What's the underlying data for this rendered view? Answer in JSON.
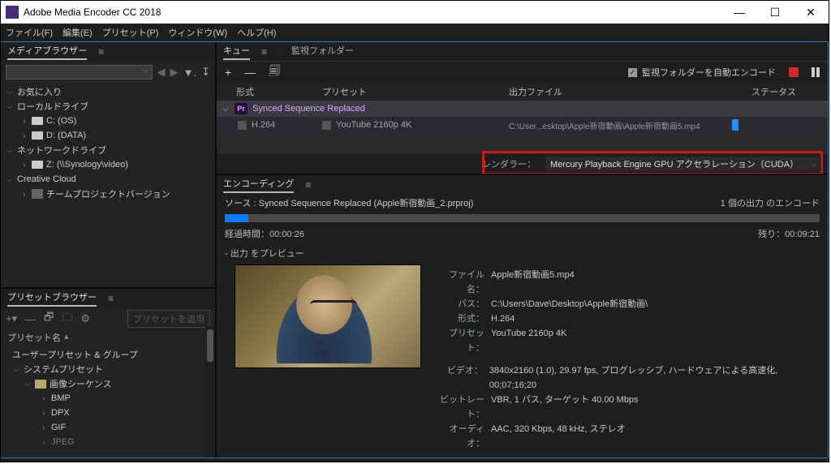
{
  "window": {
    "title": "Adobe Media Encoder CC 2018"
  },
  "menubar": {
    "file": "ファイル(F)",
    "edit": "編集(E)",
    "preset": "プリセット(P)",
    "window": "ウィンドウ(W)",
    "help": "ヘルプ(H)"
  },
  "media_browser": {
    "tab": "メディアブラウザー",
    "tree": {
      "favorites": "お気に入り",
      "local_drives": "ローカルドライブ",
      "c_drive": "C: (OS)",
      "d_drive": "D: (DATA)",
      "network_drives": "ネットワークドライブ",
      "z_drive": "Z: (\\\\Synology\\video)",
      "creative_cloud": "Creative Cloud",
      "team_projects": "チームプロジェクトバージョン"
    }
  },
  "preset_browser": {
    "tab": "プリセットブラウザー",
    "apply": "プリセットを適用",
    "col_name": "プリセット名",
    "user_presets": "ユーザープリセット & グループ",
    "system_presets": "システムプリセット",
    "image_sequence": "画像シーケンス",
    "items": [
      "BMP",
      "DPX",
      "GIF",
      "JPEG"
    ]
  },
  "queue": {
    "tab_queue": "キュー",
    "tab_watch": "監視フォルダー",
    "auto_encode": "監視フォルダーを自動エンコード",
    "headers": {
      "format": "形式",
      "preset": "プリセット",
      "output": "出力ファイル",
      "status": "ステータス"
    },
    "job": {
      "sequence": "Synced Sequence Replaced",
      "format": "H.264",
      "preset": "YouTube 2160p 4K",
      "output": "C:\\User...esktop\\Apple新宿動画\\Apple新宿動画5.mp4"
    },
    "renderer_label": "レンダラー：",
    "renderer_value": "Mercury Playback Engine GPU アクセラレーション（CUDA）"
  },
  "encoding": {
    "tab": "エンコーディング",
    "source_label": "ソース",
    "source_value": "Synced Sequence Replaced (Apple新宿動画_2.prproj)",
    "output_count": "1 個の出力 のエンコード",
    "elapsed_label": "経過時間：",
    "elapsed_value": "00:00:26",
    "remaining_label": "残り：",
    "remaining_value": "00:09:21",
    "preview_label": "- 出力 をプレビュー",
    "meta": {
      "file_label": "ファイル名：",
      "file_value": "Apple新宿動画5.mp4",
      "path_label": "パス：",
      "path_value": "C:\\Users\\Dave\\Desktop\\Apple新宿動画\\",
      "format_label": "形式：",
      "format_value": "H.264",
      "preset_label": "プリセット：",
      "preset_value": "YouTube 2160p 4K",
      "video_label": "ビデオ：",
      "video_value": "3840x2160 (1.0), 29.97 fps, プログレッシブ, ハードウェアによる高速化, 00;07;16;20",
      "bitrate_label": "ビットレート：",
      "bitrate_value": "VBR, 1 パス, ターゲット 40.00 Mbps",
      "audio_label": "オーディオ：",
      "audio_value": "AAC, 320 Kbps, 48 kHz, ステレオ"
    }
  }
}
